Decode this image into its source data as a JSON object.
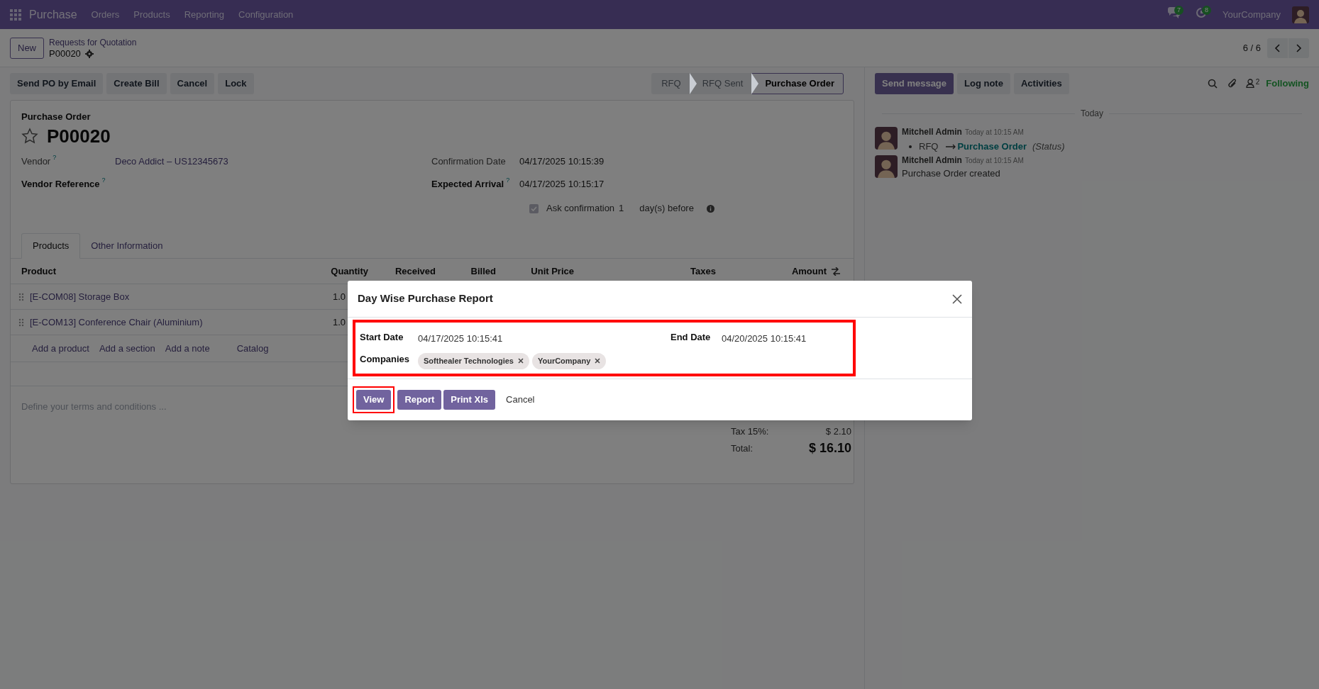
{
  "navbar": {
    "app": "Purchase",
    "menus": [
      "Orders",
      "Products",
      "Reporting",
      "Configuration"
    ],
    "messages_count": "7",
    "activities_count": "8",
    "company": "YourCompany"
  },
  "control_panel": {
    "new_button": "New",
    "breadcrumb": "Requests for Quotation",
    "record": "P00020",
    "pager": "6 / 6"
  },
  "action_buttons": [
    "Send PO by Email",
    "Create Bill",
    "Cancel",
    "Lock"
  ],
  "statusbar": [
    {
      "label": "RFQ",
      "selected": false
    },
    {
      "label": "RFQ Sent",
      "selected": false
    },
    {
      "label": "Purchase Order",
      "selected": true
    }
  ],
  "form": {
    "subtitle": "Purchase Order",
    "name": "P00020",
    "starred": false,
    "left_fields": [
      {
        "label": "Vendor",
        "help": "?",
        "required": false,
        "value": "Deco Addict – US12345673"
      },
      {
        "label": "Vendor Reference",
        "help": "?",
        "required": true
      }
    ],
    "right_fields": [
      {
        "label": "Confirmation Date",
        "required": false,
        "value": "04/17/2025 10:15:39"
      },
      {
        "label": "Expected Arrival",
        "help": "?",
        "required": true,
        "value": "04/17/2025 10:15:17"
      }
    ],
    "ask_confirmation": {
      "checked": true,
      "label": "Ask confirmation",
      "days": "1",
      "suffix": "day(s) before"
    },
    "tabs": [
      {
        "label": "Products",
        "selected": true
      },
      {
        "label": "Other Information",
        "selected": false
      }
    ],
    "columns": [
      "Product",
      "Quantity",
      "Received",
      "Billed",
      "Unit Price",
      "Taxes",
      "Amount"
    ],
    "rows": [
      {
        "product": "[E-COM08] Storage Box",
        "quantity": "1.0"
      },
      {
        "product": "[E-COM13] Conference Chair (Aluminium)",
        "quantity": "1.0"
      }
    ],
    "add_links": [
      "Add a product",
      "Add a section",
      "Add a note",
      "Catalog"
    ],
    "terms_placeholder": "Define your terms and conditions ...",
    "totals": [
      {
        "label": "Tax 15%:",
        "value": "$ 2.10",
        "kind": "line"
      },
      {
        "label": "Total:",
        "value": "$ 16.10",
        "kind": "grand"
      }
    ]
  },
  "chatter": {
    "buttons": [
      {
        "label": "Send message",
        "kind": "primary"
      },
      {
        "label": "Log note",
        "kind": "secondary"
      },
      {
        "label": "Activities",
        "kind": "secondary"
      }
    ],
    "followers_count": "2",
    "follow_label": "Following",
    "date_separator": "Today",
    "messages": [
      {
        "author": "Mitchell Admin",
        "time": "Today at 10:15 AM",
        "kind": "tracking",
        "old_value": "RFQ",
        "new_value": "Purchase Order",
        "field": "(Status)"
      },
      {
        "author": "Mitchell Admin",
        "time": "Today at 10:15 AM",
        "kind": "text",
        "body": "Purchase Order created"
      }
    ]
  },
  "modal": {
    "title": "Day Wise Purchase Report",
    "fields_highlighted": true,
    "start_label": "Start Date",
    "start_date": "04/17/2025 10:15:41",
    "end_label": "End Date",
    "end_date": "04/20/2025 10:15:41",
    "companies_label": "Companies",
    "companies": [
      "Softhealer Technologies",
      "YourCompany"
    ],
    "buttons": [
      {
        "label": "View",
        "kind": "primary",
        "highlighted": true
      },
      {
        "label": "Report",
        "kind": "primary",
        "highlighted": false
      },
      {
        "label": "Print Xls",
        "kind": "primary",
        "highlighted": false
      },
      {
        "label": "Cancel",
        "kind": "secondary",
        "highlighted": false
      }
    ]
  }
}
